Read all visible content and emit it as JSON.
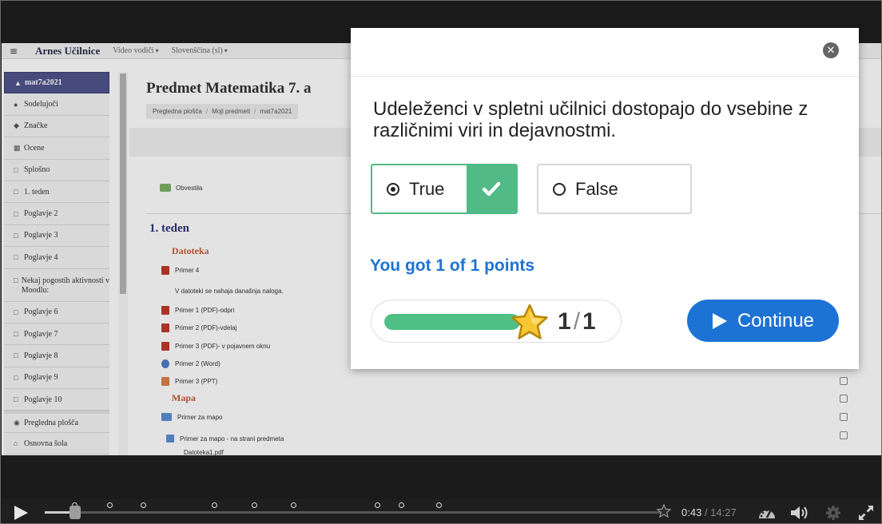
{
  "moodle": {
    "brand": "Arnes Učilnice",
    "nav": [
      "Video vodiči",
      "Slovenščina (sl)"
    ],
    "page_title": "Predmet Matematika 7. a",
    "breadcrumb": [
      "Pregledna plošča",
      "Moji predmeti",
      "mat7a2021"
    ],
    "sidebar": [
      {
        "label": "mat7a2021",
        "icon": "graduation-cap-icon"
      },
      {
        "label": "Sodelujoči",
        "icon": "users-icon"
      },
      {
        "label": "Značke",
        "icon": "shield-icon"
      },
      {
        "label": "Ocene",
        "icon": "table-icon"
      },
      {
        "label": "Splošno",
        "icon": "folder-icon"
      },
      {
        "label": "1. teden",
        "icon": "folder-icon"
      },
      {
        "label": "Poglavje 2",
        "icon": "folder-icon"
      },
      {
        "label": "Poglavje 3",
        "icon": "folder-icon"
      },
      {
        "label": "Poglavje 4",
        "icon": "folder-icon"
      },
      {
        "label": "Nekaj pogostih aktivnosti v Moodlu:",
        "icon": "folder-icon"
      },
      {
        "label": "Poglavje 6",
        "icon": "folder-icon"
      },
      {
        "label": "Poglavje 7",
        "icon": "folder-icon"
      },
      {
        "label": "Poglavje 8",
        "icon": "folder-icon"
      },
      {
        "label": "Poglavje 9",
        "icon": "folder-icon"
      },
      {
        "label": "Poglavje 10",
        "icon": "folder-icon"
      },
      {
        "label": "Pregledna plošča",
        "icon": "dashboard-icon"
      },
      {
        "label": "Osnovna šola",
        "icon": "home-icon"
      }
    ],
    "news": "Obvestila",
    "week": "1. teden",
    "sub1": "Datoteka",
    "sub2": "Mapa",
    "activities": {
      "primer4": "Primer 4",
      "note": "V datoteki se nahaja današnja naloga.",
      "primer1": "Primer 1 (PDF)-odpri",
      "primer2": "Primer 2 (PDF)-vdelaj",
      "primer3": "Primer 3 (PDF)- v pojavnem oknu",
      "primer2w": "Primer 2 (Word)",
      "primer3p": "Primer 3 (PPT)",
      "mapa": "Primer za mapo",
      "mapa2": "Primer za mapo - na strani predmeta",
      "file": "Datoteka1.pdf"
    }
  },
  "quiz": {
    "question": "Udeleženci v spletni učilnici dostopajo do vsebine z različnimi viri in dejavnostmi.",
    "options": [
      {
        "label": "True",
        "selected": true,
        "correct": true
      },
      {
        "label": "False",
        "selected": false
      }
    ],
    "result": "You got 1 of 1 points",
    "score": "1",
    "score_max": "1",
    "score_fraction": 1.0,
    "continue_label": "Continue",
    "colors": {
      "accent": "#1d73d3",
      "correct": "#51ba86",
      "star": "#f7c631"
    }
  },
  "player": {
    "current_time": "0:43",
    "separator": "/",
    "duration": "14:27",
    "played_fraction": 0.05,
    "icons": [
      "play-icon",
      "gauge-icon",
      "volume-icon",
      "settings-icon",
      "fullscreen-icon"
    ]
  }
}
